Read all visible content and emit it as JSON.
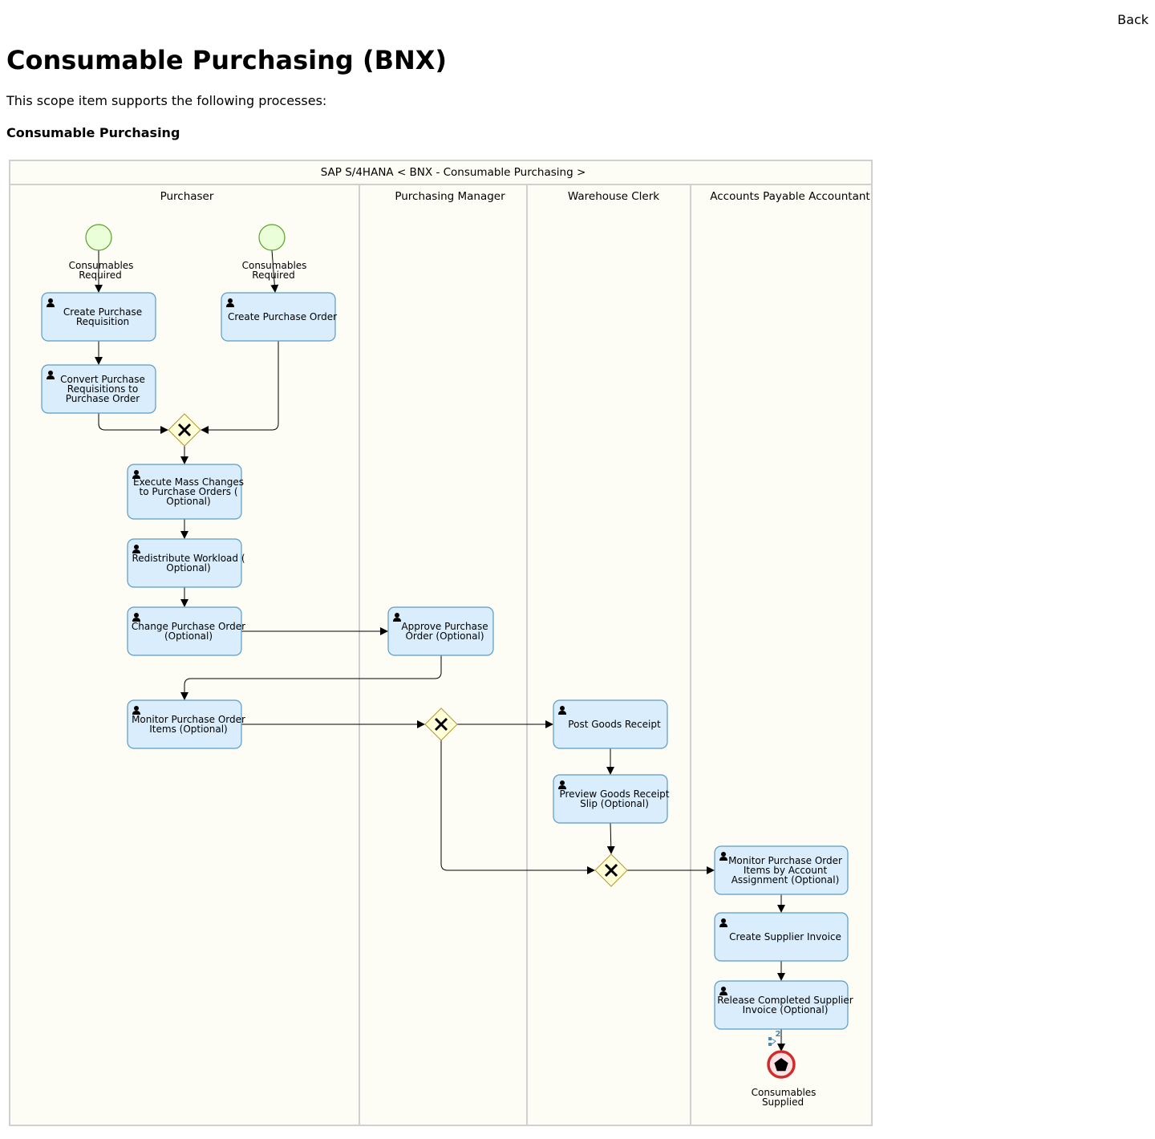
{
  "header": {
    "back_label": "Back",
    "title": "Consumable Purchasing (BNX)",
    "intro": "This scope item supports the following processes:",
    "process_name": "Consumable Purchasing"
  },
  "diagram": {
    "pool_title": "SAP S/4HANA < BNX - Consumable Purchasing >",
    "lanes": [
      "Purchaser",
      "Purchasing Manager",
      "Warehouse Clerk",
      "Accounts Payable Accountant"
    ],
    "start_events": [
      {
        "id": "s1",
        "label": [
          "Consumables",
          "Required"
        ]
      },
      {
        "id": "s2",
        "label": [
          "Consumables",
          "Required"
        ]
      }
    ],
    "tasks": [
      {
        "id": "t1",
        "lines": [
          "Create Purchase",
          "Requisition"
        ],
        "icon": "user-icon"
      },
      {
        "id": "t2",
        "lines": [
          "Create Purchase Order"
        ],
        "icon": "user-icon"
      },
      {
        "id": "t3",
        "lines": [
          "Convert Purchase",
          "Requisitions to",
          "Purchase Order"
        ],
        "icon": "user-icon"
      },
      {
        "id": "t4",
        "lines": [
          "Execute Mass Changes",
          "to Purchase Orders (",
          "Optional)"
        ],
        "icon": "user-icon"
      },
      {
        "id": "t5",
        "lines": [
          "Redistribute Workload (",
          "Optional)"
        ],
        "icon": "user-icon"
      },
      {
        "id": "t6",
        "lines": [
          "Change Purchase Order",
          "(Optional)"
        ],
        "icon": "user-icon"
      },
      {
        "id": "t7",
        "lines": [
          "Approve Purchase",
          "Order (Optional)"
        ],
        "icon": "user-icon"
      },
      {
        "id": "t8",
        "lines": [
          "Monitor Purchase Order",
          "Items (Optional)"
        ],
        "icon": "user-icon"
      },
      {
        "id": "t9",
        "lines": [
          "Post Goods Receipt"
        ],
        "icon": "user-icon"
      },
      {
        "id": "t10",
        "lines": [
          "Preview Goods Receipt",
          "Slip (Optional)"
        ],
        "icon": "user-icon"
      },
      {
        "id": "t11",
        "lines": [
          "Monitor Purchase Order",
          "Items by Account",
          "Assignment (Optional)"
        ],
        "icon": "user-icon"
      },
      {
        "id": "t12",
        "lines": [
          "Create Supplier Invoice"
        ],
        "icon": "user-icon"
      },
      {
        "id": "t13",
        "lines": [
          "Release Completed Supplier",
          "Invoice (Optional)"
        ],
        "icon": "user-icon"
      }
    ],
    "gateways": [
      {
        "id": "g1",
        "type": "exclusive"
      },
      {
        "id": "g2",
        "type": "exclusive"
      },
      {
        "id": "g3",
        "type": "exclusive"
      }
    ],
    "end_event": {
      "id": "e1",
      "label": [
        "Consumables",
        "Supplied"
      ]
    },
    "badge_count": "2",
    "colors": {
      "pool_bg": "#fdfdf5",
      "pool_border": "#d0d0d0",
      "task_fill": "#d9edfc",
      "task_stroke": "#5b9bc4",
      "start_fill": "#eaffd9",
      "start_stroke": "#5aa02c",
      "gateway_fill": "#ffffd9",
      "gateway_stroke": "#b8962e",
      "end_fill": "#fde3e3",
      "end_stroke": "#d12c2c",
      "edge": "#000000"
    }
  }
}
